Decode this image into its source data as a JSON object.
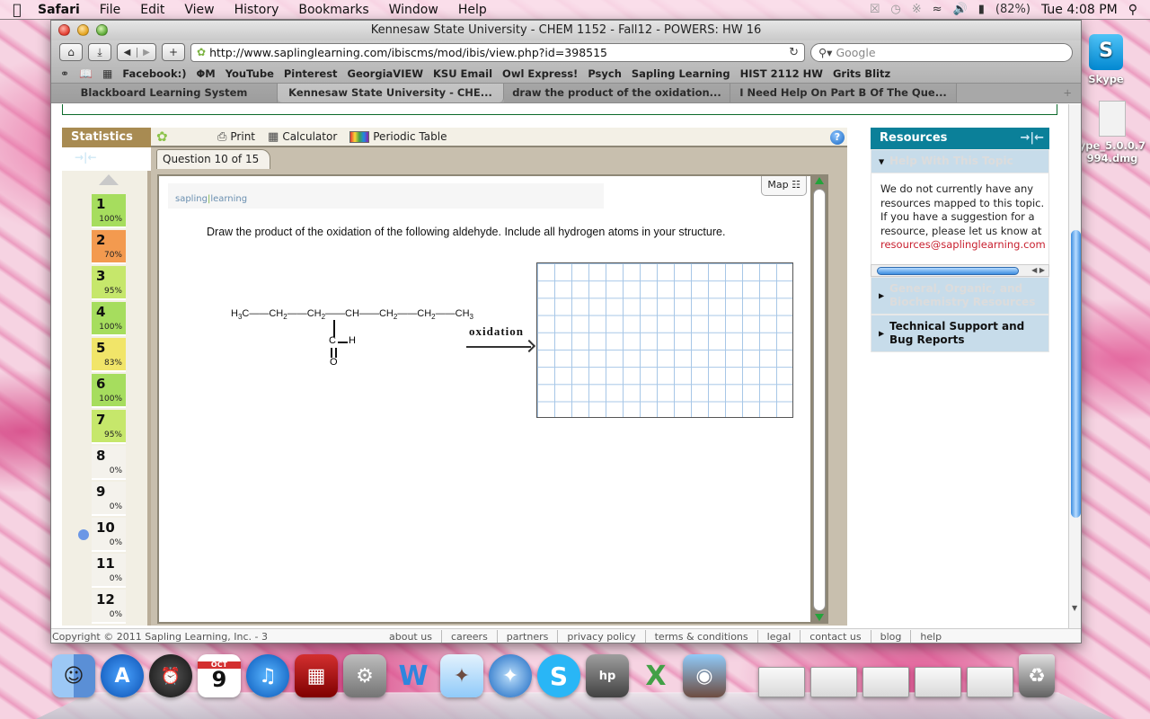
{
  "menubar": {
    "apple": "",
    "app_name": "Safari",
    "menus": [
      "File",
      "Edit",
      "View",
      "History",
      "Bookmarks",
      "Window",
      "Help"
    ],
    "battery": "(82%)",
    "clock": "Tue 4:08 PM"
  },
  "window": {
    "title": "Kennesaw State University - CHEM 1152 - Fall12 - POWERS: HW 16",
    "url": "http://www.saplinglearning.com/ibiscms/mod/ibis/view.php?id=398515",
    "search_placeholder": "Google",
    "bookmarks": [
      "Facebook:)",
      "ΦM",
      "YouTube",
      "Pinterest",
      "GeorgiaVIEW",
      "KSU Email",
      "Owl Express!",
      "Psych",
      "Sapling Learning",
      "HIST 2112 HW",
      "Grits Blitz"
    ],
    "tabs": [
      {
        "label": "Blackboard Learning System",
        "active": false
      },
      {
        "label": "Kennesaw State University - CHE...",
        "active": true
      },
      {
        "label": "draw the product of the oxidation...",
        "active": false
      },
      {
        "label": "I Need Help On Part B Of The Que...",
        "active": false
      }
    ],
    "new_tab": "+"
  },
  "sapling": {
    "statistics_label": "Statistics",
    "tools": [
      "Print",
      "Calculator",
      "Periodic Table"
    ],
    "help_icon": "?",
    "question_tab": "Question 10 of 15",
    "current_question": 10,
    "questions": [
      {
        "num": "1",
        "pct": "100%",
        "color": "#a6dd5e"
      },
      {
        "num": "2",
        "pct": "70%",
        "color": "#f39a4f"
      },
      {
        "num": "3",
        "pct": "95%",
        "color": "#c6e76b"
      },
      {
        "num": "4",
        "pct": "100%",
        "color": "#a6dd5e"
      },
      {
        "num": "5",
        "pct": "83%",
        "color": "#f1e569"
      },
      {
        "num": "6",
        "pct": "100%",
        "color": "#a6dd5e"
      },
      {
        "num": "7",
        "pct": "95%",
        "color": "#c6e76b"
      },
      {
        "num": "8",
        "pct": "0%",
        "color": "#f4f2ec"
      },
      {
        "num": "9",
        "pct": "0%",
        "color": "#f4f2ec"
      },
      {
        "num": "10",
        "pct": "0%",
        "color": "#f4f2ec"
      },
      {
        "num": "11",
        "pct": "0%",
        "color": "#f4f2ec"
      },
      {
        "num": "12",
        "pct": "0%",
        "color": "#f4f2ec"
      }
    ],
    "logo": {
      "left": "sapling",
      "right": "learning"
    },
    "map_label": "Map",
    "question_text": "Draw the product of the oxidation of the following aldehyde. Include all hydrogen atoms in your structure.",
    "molecule": {
      "chain": [
        "H3C",
        "CH2",
        "CH2",
        "CH",
        "CH2",
        "CH2",
        "CH3"
      ],
      "branch_carbon": "C",
      "branch_h": "H",
      "branch_o": "O"
    },
    "arrow_label": "oxidation"
  },
  "resources": {
    "title": "Resources",
    "sections": [
      {
        "label": "Help With This Topic",
        "expanded": true
      },
      {
        "label": "General, Organic, and Biochemistry Resources",
        "expanded": false
      },
      {
        "label": "Technical Support and Bug Reports",
        "expanded": false
      }
    ],
    "help_text": "We do not currently have any resources mapped to this topic. If you have a suggestion for a resource, please let us know at",
    "email": "resources@saplinglearning.com"
  },
  "footer": {
    "copyright": "Copyright © 2011 Sapling Learning, Inc. - 3",
    "links": [
      "about us",
      "careers",
      "partners",
      "privacy policy",
      "terms & conditions",
      "legal",
      "contact us",
      "blog",
      "help"
    ]
  },
  "desktop": {
    "icons": [
      {
        "label": "Skype"
      },
      {
        "label": "ype_5.0.0.7 994.dmg"
      }
    ]
  },
  "dock": {
    "apps": [
      "Finder",
      "App Store",
      "Dashboard",
      "iCal",
      "iTunes",
      "Photo Booth",
      "System Preferences",
      "Microsoft Word",
      "Mail",
      "Safari",
      "Skype",
      "HP Utility",
      "Microsoft Excel",
      "iPhoto"
    ],
    "calendar_month": "OCT",
    "calendar_day": "9",
    "minimized_windows": 5
  }
}
